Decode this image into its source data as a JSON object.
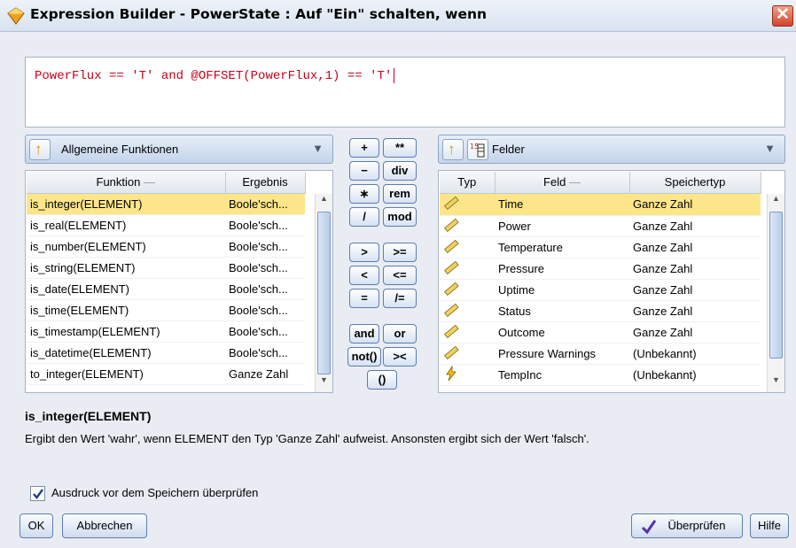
{
  "window": {
    "title": "Expression Builder - PowerState : Auf \"Ein\" schalten, wenn",
    "close_glyph": "✕",
    "icon": "diamond-app-icon"
  },
  "expression": "PowerFlux == 'T' and @OFFSET(PowerFlux,1) == 'T'",
  "functions_panel": {
    "dropdown_label": "Allgemeine Funktionen",
    "columns": [
      "Funktion",
      "Ergebnis"
    ],
    "rows": [
      {
        "name": "is_integer(ELEMENT)",
        "result": "Boole'sch..."
      },
      {
        "name": "is_real(ELEMENT)",
        "result": "Boole'sch..."
      },
      {
        "name": "is_number(ELEMENT)",
        "result": "Boole'sch..."
      },
      {
        "name": "is_string(ELEMENT)",
        "result": "Boole'sch..."
      },
      {
        "name": "is_date(ELEMENT)",
        "result": "Boole'sch..."
      },
      {
        "name": "is_time(ELEMENT)",
        "result": "Boole'sch..."
      },
      {
        "name": "is_timestamp(ELEMENT)",
        "result": "Boole'sch..."
      },
      {
        "name": "is_datetime(ELEMENT)",
        "result": "Boole'sch..."
      },
      {
        "name": "to_integer(ELEMENT)",
        "result": "Ganze Zahl"
      }
    ]
  },
  "operators": {
    "plus": "+",
    "power": "**",
    "minus": "−",
    "div": "div",
    "times": "∗",
    "rem": "rem",
    "divide": "/",
    "mod": "mod",
    "gt": ">",
    "ge": ">=",
    "lt": "<",
    "le": "<=",
    "eq": "=",
    "ne": "/=",
    "and": "and",
    "or": "or",
    "not": "not()",
    "concat": "><",
    "parens": "()"
  },
  "fields_panel": {
    "dropdown_label": "Felder",
    "columns": [
      "Typ",
      "Feld",
      "Speichertyp"
    ],
    "rows": [
      {
        "type_icon": "ruler-icon",
        "field": "Time",
        "storage": "Ganze Zahl"
      },
      {
        "type_icon": "ruler-icon",
        "field": "Power",
        "storage": "Ganze Zahl"
      },
      {
        "type_icon": "ruler-icon",
        "field": "Temperature",
        "storage": "Ganze Zahl"
      },
      {
        "type_icon": "ruler-icon",
        "field": "Pressure",
        "storage": "Ganze Zahl"
      },
      {
        "type_icon": "ruler-icon",
        "field": "Uptime",
        "storage": "Ganze Zahl"
      },
      {
        "type_icon": "ruler-icon",
        "field": "Status",
        "storage": "Ganze Zahl"
      },
      {
        "type_icon": "ruler-icon",
        "field": "Outcome",
        "storage": "Ganze Zahl"
      },
      {
        "type_icon": "ruler-icon",
        "field": "Pressure Warnings",
        "storage": "(Unbekannt)"
      },
      {
        "type_icon": "lightning-icon",
        "field": "TempInc",
        "storage": "(Unbekannt)"
      }
    ]
  },
  "description": {
    "title": "is_integer(ELEMENT)",
    "text": "Ergibt den Wert 'wahr', wenn ELEMENT den Typ 'Ganze Zahl' aufweist. Ansonsten ergibt sich der Wert 'falsch'."
  },
  "check_before_save": {
    "label": "Ausdruck vor dem Speichern überprüfen",
    "checked": true
  },
  "buttons": {
    "ok": "OK",
    "cancel": "Abbrechen",
    "check": "Überprüfen",
    "help": "Hilfe"
  },
  "colors": {
    "expression_text": "#c8001a",
    "selected_row": "#fde68a",
    "up_arrow": "#d09a00"
  }
}
